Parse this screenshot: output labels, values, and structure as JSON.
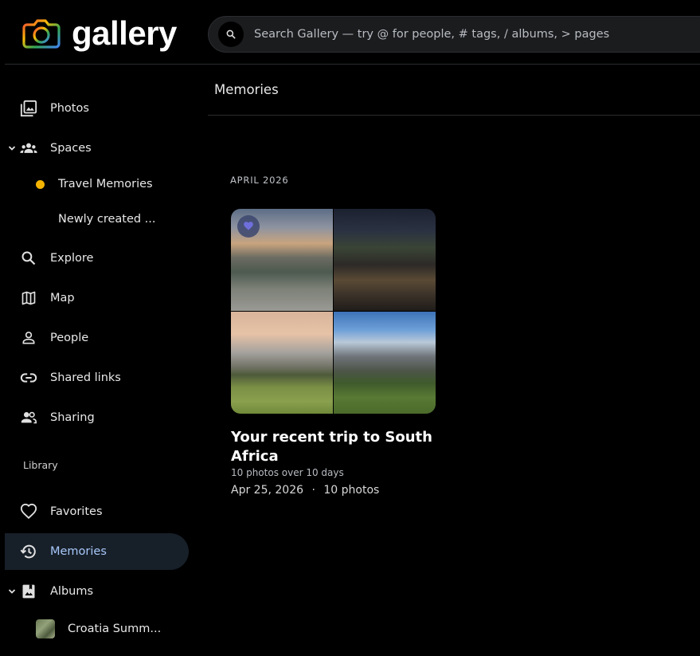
{
  "app": {
    "name": "gallery"
  },
  "search": {
    "placeholder": "Search Gallery — try @ for people, # tags, / albums, > pages"
  },
  "sidebar": {
    "items": [
      {
        "label": "Photos"
      },
      {
        "label": "Spaces"
      },
      {
        "label": "Travel Memories"
      },
      {
        "label": "Newly created ..."
      },
      {
        "label": "Explore"
      },
      {
        "label": "Map"
      },
      {
        "label": "People"
      },
      {
        "label": "Shared links"
      },
      {
        "label": "Sharing"
      }
    ],
    "library_label": "Library",
    "library_items": [
      {
        "label": "Favorites"
      },
      {
        "label": "Memories"
      },
      {
        "label": "Albums"
      },
      {
        "label": "Croatia Summ..."
      }
    ],
    "space_dot_color": "#f4b400",
    "active_color": "#a8c7fa"
  },
  "main": {
    "title": "Memories",
    "month": "APRIL 2026",
    "memory": {
      "title": "Your recent trip to South Africa",
      "subtitle": "10 photos over 10 days",
      "date": "Apr 25, 2026",
      "separator": "·",
      "count": "10 photos"
    }
  }
}
